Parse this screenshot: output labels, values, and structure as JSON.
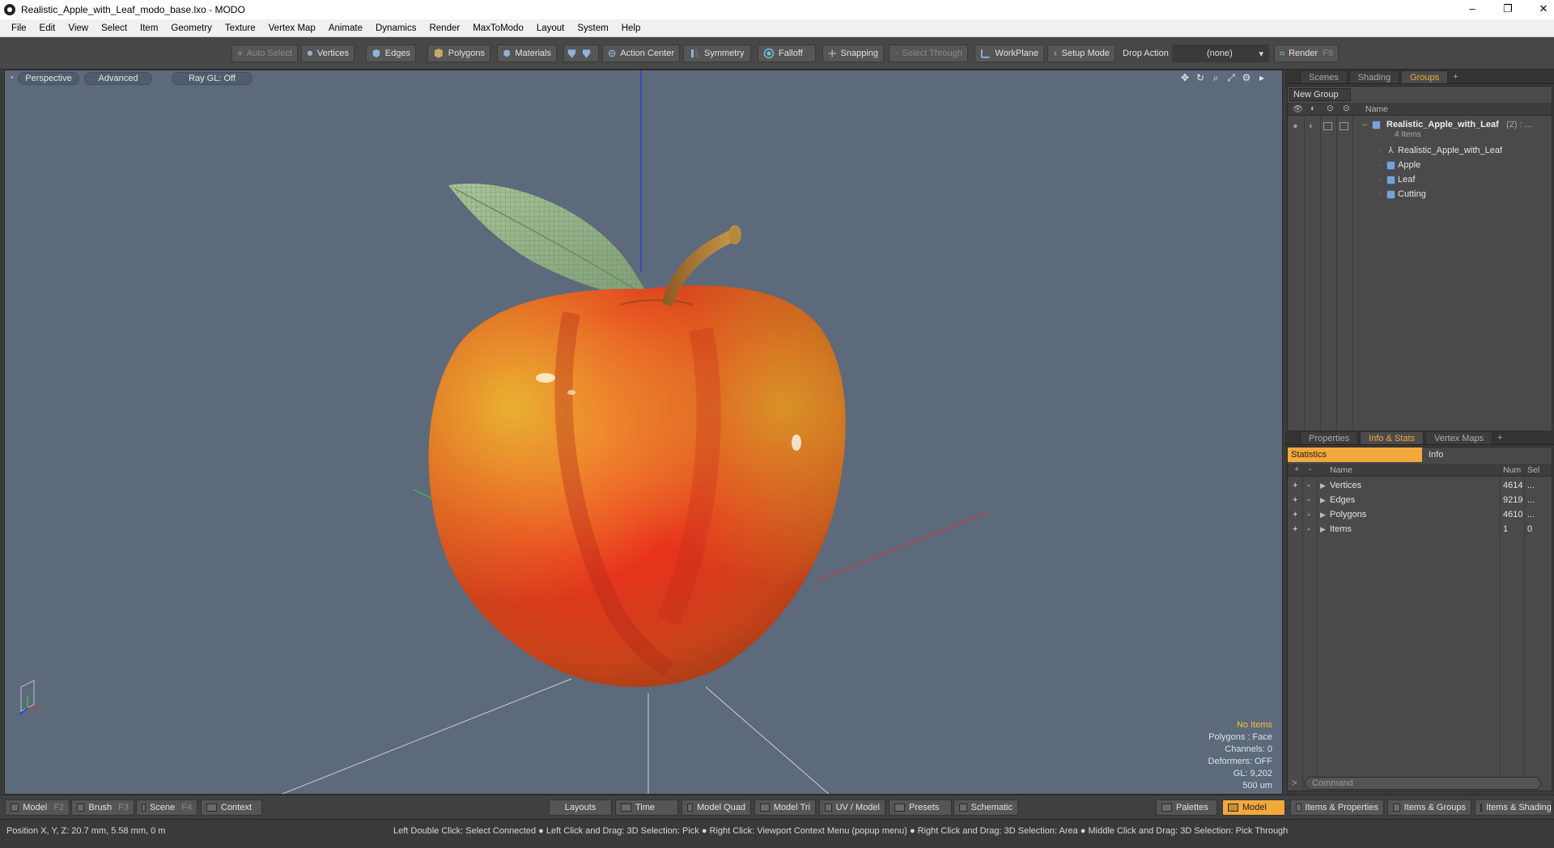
{
  "window": {
    "title": "Realistic_Apple_with_Leaf_modo_base.lxo - MODO",
    "minimize": "–",
    "maximize": "❐",
    "close": "✕"
  },
  "menu": [
    "File",
    "Edit",
    "View",
    "Select",
    "Item",
    "Geometry",
    "Texture",
    "Vertex Map",
    "Animate",
    "Dynamics",
    "Render",
    "MaxToModo",
    "Layout",
    "System",
    "Help"
  ],
  "toolbar": {
    "auto_select": "Auto Select",
    "vertices": "Vertices",
    "edges": "Edges",
    "polygons": "Polygons",
    "materials": "Materials",
    "action_center": "Action Center",
    "symmetry": "Symmetry",
    "falloff": "Falloff",
    "snapping": "Snapping",
    "select_through": "Select Through",
    "workplane": "WorkPlane",
    "setup_mode": "Setup Mode",
    "drop_action_label": "Drop Action",
    "drop_action_value": "(none)",
    "render": "Render",
    "render_key": "F9"
  },
  "viewport": {
    "view_mode": "Perspective",
    "shading": "Advanced",
    "raygl": "Ray GL: Off",
    "stats": {
      "selection": "No Items",
      "polygons": "Polygons : Face",
      "channels": "Channels: 0",
      "deformers": "Deformers: OFF",
      "gl": "GL: 9,202",
      "scale": "500 um"
    }
  },
  "groups_panel": {
    "tabs": [
      "Scenes",
      "Shading",
      "Groups"
    ],
    "active_tab": "Groups",
    "new_group": "New Group",
    "name_header": "Name",
    "group_name": "Realistic_Apple_with_Leaf",
    "group_count": "(2) : ...",
    "group_items": "4 Items",
    "items": [
      "Realistic_Apple_with_Leaf",
      "Apple",
      "Leaf",
      "Cutting"
    ]
  },
  "stats_panel": {
    "tabs": [
      "Properties",
      "Info & Stats",
      "Vertex Maps"
    ],
    "active_tab": "Info & Stats",
    "sub_statistics": "Statistics",
    "sub_info": "Info",
    "headers": {
      "name": "Name",
      "num": "Num",
      "sel": "Sel"
    },
    "rows": [
      {
        "name": "Vertices",
        "num": "4614",
        "sel": "..."
      },
      {
        "name": "Edges",
        "num": "9219",
        "sel": "..."
      },
      {
        "name": "Polygons",
        "num": "4610",
        "sel": "..."
      },
      {
        "name": "Items",
        "num": "1",
        "sel": "0"
      }
    ],
    "command_placeholder": "Command"
  },
  "bottom": {
    "model": "Model",
    "model_key": "F2",
    "brush": "Brush",
    "brush_key": "F3",
    "scene": "Scene",
    "scene_key": "F4",
    "context": "Context",
    "layouts": "Layouts",
    "time": "Time",
    "model_quad": "Model Quad",
    "model_tri": "Model Tri",
    "uv_model": "UV / Model",
    "presets": "Presets",
    "schematic": "Schematic",
    "palettes": "Palettes",
    "model_layout": "Model",
    "items_properties": "Items & Properties",
    "items_groups": "Items & Groups",
    "items_shading": "Items & Shading"
  },
  "status": {
    "position": "Position X, Y, Z:   20.7 mm, 5.58 mm, 0 m",
    "hint": "Left Double Click: Select Connected ● Left Click and Drag: 3D Selection: Pick ● Right Click: Viewport Context Menu (popup menu) ● Right Click and Drag: 3D Selection: Area ● Middle Click and Drag: 3D Selection: Pick Through"
  }
}
